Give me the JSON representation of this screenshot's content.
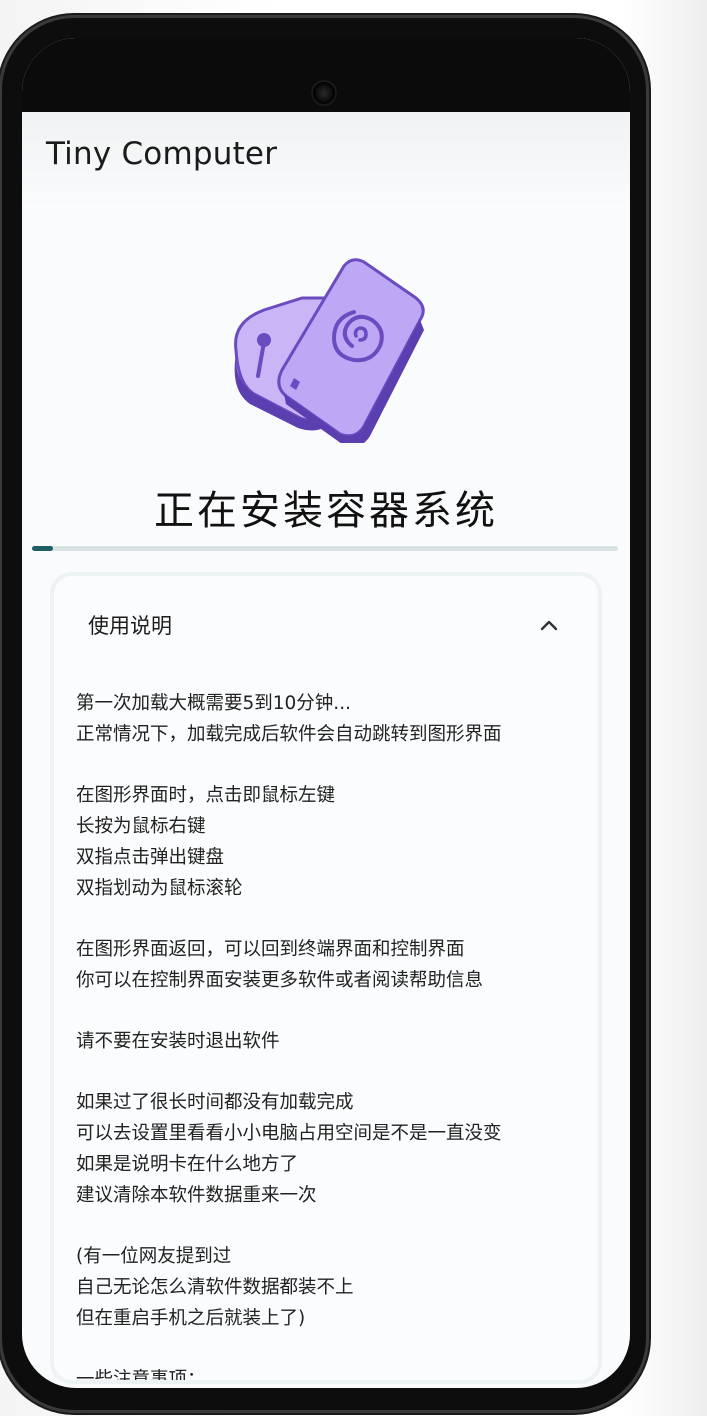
{
  "app": {
    "title": "Tiny Computer"
  },
  "status": {
    "title": "正在安装容器系统",
    "progress": 0.035
  },
  "instructions": {
    "title": "使用说明",
    "expanded": true,
    "collapse_icon": "chevron-up-icon",
    "paragraphs": [
      [
        "第一次加载大概需要5到10分钟...",
        "正常情况下，加载完成后软件会自动跳转到图形界面"
      ],
      [
        "在图形界面时，点击即鼠标左键",
        "长按为鼠标右键",
        "双指点击弹出键盘",
        "双指划动为鼠标滚轮"
      ],
      [
        "在图形界面返回，可以回到终端界面和控制界面",
        "你可以在控制界面安装更多软件或者阅读帮助信息"
      ],
      [
        "请不要在安装时退出软件"
      ],
      [
        "如果过了很长时间都没有加载完成",
        "可以去设置里看看小小电脑占用空间是不是一直没变",
        "如果是说明卡在什么地方了",
        "建议清除本软件数据重来一次"
      ],
      [
        "(有一位网友提到过",
        "自己无论怎么清软件数据都装不上",
        "但在重启手机之后就装上了)"
      ],
      [
        "一些注意事项："
      ]
    ]
  },
  "colors": {
    "accent": "#1f5e63",
    "track": "#d9e2e4",
    "logo_purple": "#c5b3f6",
    "logo_dark": "#5b3fb0"
  },
  "icons": {
    "logo": "tiny-computer-logo-icon",
    "camera": "front-camera"
  }
}
